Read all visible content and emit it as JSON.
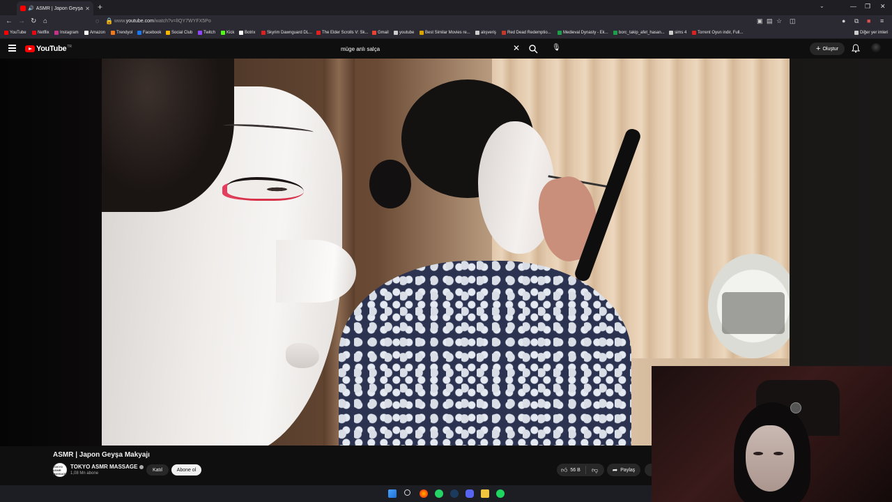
{
  "browser": {
    "tab_title": "ASMR | Japon Geyşa Makya...",
    "url_prefix": "www.",
    "url_domain": "youtube.com",
    "url_path": "/watch?v=lIQY7WYFX5Po",
    "window_controls": {
      "minimize": "—",
      "restore": "❐",
      "close": "✕"
    },
    "bookmarks": [
      {
        "label": "YouTube",
        "color": "#ff0000"
      },
      {
        "label": "Netflix",
        "color": "#e50914"
      },
      {
        "label": "Instagram",
        "color": "#c13584"
      },
      {
        "label": "Amazon",
        "color": "#ffffff"
      },
      {
        "label": "Trendyol",
        "color": "#f27a1a"
      },
      {
        "label": "Facebook",
        "color": "#1877f2"
      },
      {
        "label": "Social Club",
        "color": "#f7b500"
      },
      {
        "label": "Twitch",
        "color": "#9146ff"
      },
      {
        "label": "Kick",
        "color": "#53fc18"
      },
      {
        "label": "Botrix",
        "color": "#ffffff"
      },
      {
        "label": "Skyrim Dawnguard DL...",
        "color": "#e02020"
      },
      {
        "label": "The Elder Scrolls V: Sk...",
        "color": "#e02020"
      },
      {
        "label": "Gmail",
        "color": "#ea4335"
      },
      {
        "label": "youtube",
        "color": "#cccccc"
      },
      {
        "label": "Best Similar Movies re...",
        "color": "#d9a400"
      },
      {
        "label": "alışveriş",
        "color": "#cccccc"
      },
      {
        "label": "Red Dead Redemptio...",
        "color": "#c0392b"
      },
      {
        "label": "Medieval Dynasty - Ek...",
        "color": "#1e9e4a"
      },
      {
        "label": "borc_takip_afet_hasan...",
        "color": "#1e9e4a"
      },
      {
        "label": "sims 4",
        "color": "#cccccc"
      },
      {
        "label": "Torrent Oyun indir, Full...",
        "color": "#e02020"
      }
    ],
    "other_bookmarks": "Diğer yer imleri"
  },
  "youtube": {
    "logo_text": "YouTube",
    "logo_region": "TR",
    "search_value": "müge anlı salça",
    "create_label": "Oluştur",
    "video": {
      "title": "ASMR | Japon Geyşa Makyajı",
      "channel_name": "TOKYO ASMR MASSAGE",
      "channel_avatar_text": "TOKYO ASMR MASSAGE",
      "subscribers": "1,08 Mn abone",
      "join_label": "Katıl",
      "subscribe_label": "Abone ol",
      "likes": "56 B",
      "share_label": "Paylaş"
    }
  },
  "colors": {
    "yt_red": "#ff0000",
    "yt_bg": "#0f0f0f",
    "chip_bg": "#272727"
  }
}
